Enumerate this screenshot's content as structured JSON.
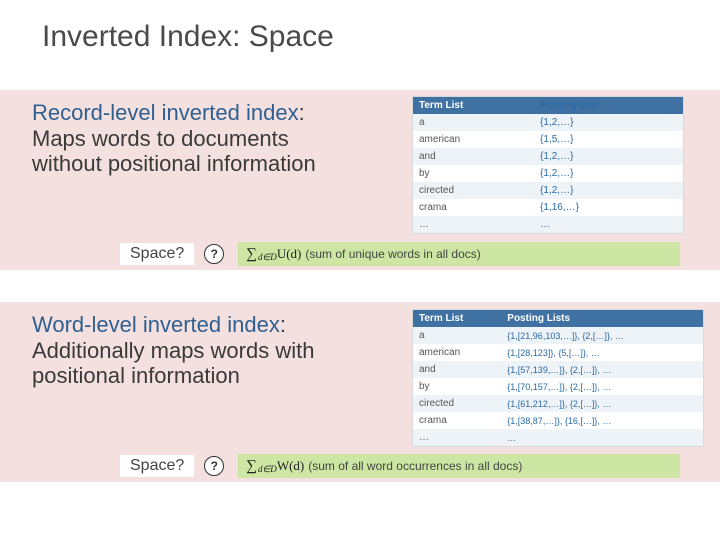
{
  "slide": {
    "title": "Inverted Index: Space"
  },
  "section1": {
    "term": "Record-level inverted index",
    "colon": ":",
    "desc_l1": "Maps words to documents",
    "desc_l2": "without positional information",
    "space_label": "Space?",
    "q_mark": "?",
    "formula_sigma": "∑",
    "formula_sub": "d∈D",
    "formula_fn": " U(d) ",
    "formula_desc": "(sum of unique words in all docs)",
    "table": {
      "h1": "Term List",
      "h2": "Posting List",
      "rows": [
        [
          "a",
          "{1,2,…}"
        ],
        [
          "american",
          "{1,5,…}"
        ],
        [
          "and",
          "{1,2,…}"
        ],
        [
          "by",
          "{1,2,…}"
        ],
        [
          "cirected",
          "{1,2,…}"
        ],
        [
          "crama",
          "{1,16,…}"
        ],
        [
          "…",
          "…"
        ]
      ]
    }
  },
  "section2": {
    "term": "Word-level inverted index",
    "colon": ":",
    "desc_l1": "Additionally maps words with",
    "desc_l2": "positional information",
    "space_label": "Space?",
    "q_mark": "?",
    "formula_sigma": "∑",
    "formula_sub": "d∈D",
    "formula_fn": " W(d) ",
    "formula_desc": "(sum of all word occurrences in all docs)",
    "table": {
      "h1": "Term List",
      "h2": "Posting Lists",
      "rows": [
        [
          "a",
          "{1,[21,96,103,…]}, {2,[…]}, …"
        ],
        [
          "american",
          "{1,[28,123]}, {5,[…]}, …"
        ],
        [
          "and",
          "{1,[57,139,…]}, {2,[…]}, …"
        ],
        [
          "by",
          "{1,[70,157,…]}, {2,[…]}, …"
        ],
        [
          "cirected",
          "{1,[61,212,…]}, {2,[…]}, …"
        ],
        [
          "crama",
          "{1,[38,87,…]}, {16,[…]}, …"
        ],
        [
          "…",
          "…"
        ]
      ]
    }
  }
}
